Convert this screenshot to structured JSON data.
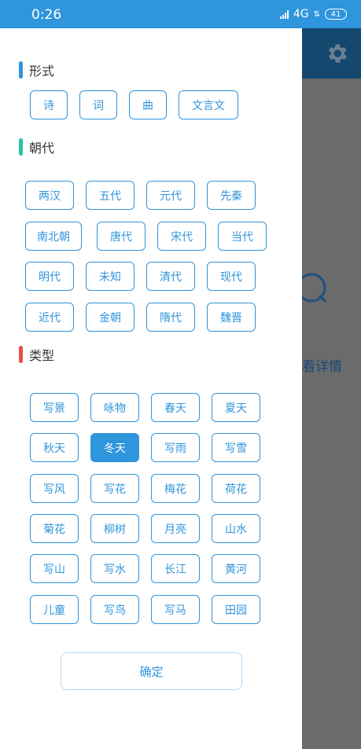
{
  "status": {
    "time": "0:26",
    "network": "4G",
    "battery": "41"
  },
  "background": {
    "detail_text": "看详情"
  },
  "sections": {
    "form": {
      "title": "形式",
      "color": "#2f95dc",
      "tags": [
        "诗",
        "词",
        "曲",
        "文言文"
      ]
    },
    "dynasty": {
      "title": "朝代",
      "color": "#29c0a8",
      "tags": [
        "两汉",
        "五代",
        "元代",
        "先秦",
        "南北朝",
        "唐代",
        "宋代",
        "当代",
        "明代",
        "未知",
        "清代",
        "现代",
        "近代",
        "金朝",
        "隋代",
        "魏晋"
      ]
    },
    "type": {
      "title": "类型",
      "color": "#e8504c",
      "selected": "冬天",
      "tags": [
        "写景",
        "咏物",
        "春天",
        "夏天",
        "秋天",
        "冬天",
        "写雨",
        "写雪",
        "写风",
        "写花",
        "梅花",
        "荷花",
        "菊花",
        "柳树",
        "月亮",
        "山水",
        "写山",
        "写水",
        "长江",
        "黄河",
        "儿童",
        "写鸟",
        "写马",
        "田园"
      ]
    }
  },
  "confirm_label": "确定",
  "colors": {
    "accent": "#2f95dc",
    "dim_overlay": "#6b6b6b",
    "toolbar_dark": "#14486e"
  }
}
